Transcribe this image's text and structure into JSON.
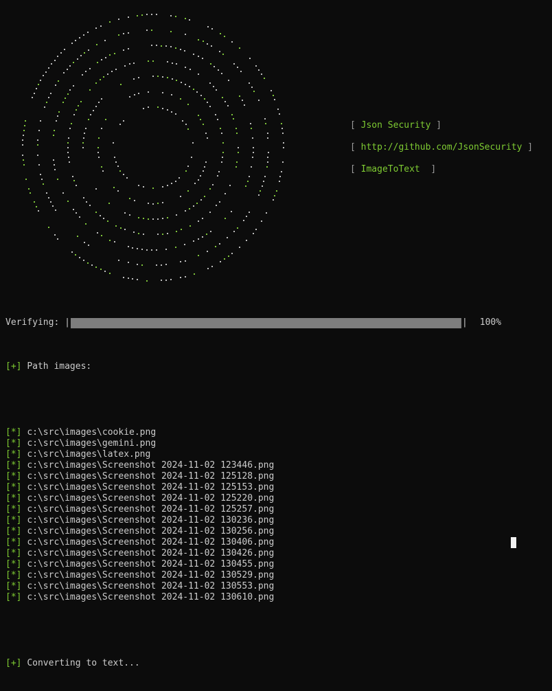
{
  "info": {
    "line1": "Json Security",
    "line2": "http://github.com/JsonSecurity",
    "line3": "ImageToText"
  },
  "progress": {
    "label": "Verifying:",
    "percent_text": "100%",
    "fraction": 1.0
  },
  "log": {
    "tag_plus": "[+]",
    "tag_star": "[*]",
    "path_header": "Path images:",
    "files": [
      "c:\\src\\images\\cookie.png",
      "c:\\src\\images\\gemini.png",
      "c:\\src\\images\\latex.png",
      "c:\\src\\images\\Screenshot 2024-11-02 123446.png",
      "c:\\src\\images\\Screenshot 2024-11-02 125128.png",
      "c:\\src\\images\\Screenshot 2024-11-02 125153.png",
      "c:\\src\\images\\Screenshot 2024-11-02 125220.png",
      "c:\\src\\images\\Screenshot 2024-11-02 125257.png",
      "c:\\src\\images\\Screenshot 2024-11-02 130236.png",
      "c:\\src\\images\\Screenshot 2024-11-02 130256.png",
      "c:\\src\\images\\Screenshot 2024-11-02 130406.png",
      "c:\\src\\images\\Screenshot 2024-11-02 130426.png",
      "c:\\src\\images\\Screenshot 2024-11-02 130455.png",
      "c:\\src\\images\\Screenshot 2024-11-02 130529.png",
      "c:\\src\\images\\Screenshot 2024-11-02 130553.png",
      "c:\\src\\images\\Screenshot 2024-11-02 130610.png"
    ],
    "converting": "Converting to text..."
  },
  "colors": {
    "background": "#0c0c0c",
    "text": "#cccccc",
    "accent_green": "#7ecb32",
    "progress_fill": "#7d7d7d"
  }
}
